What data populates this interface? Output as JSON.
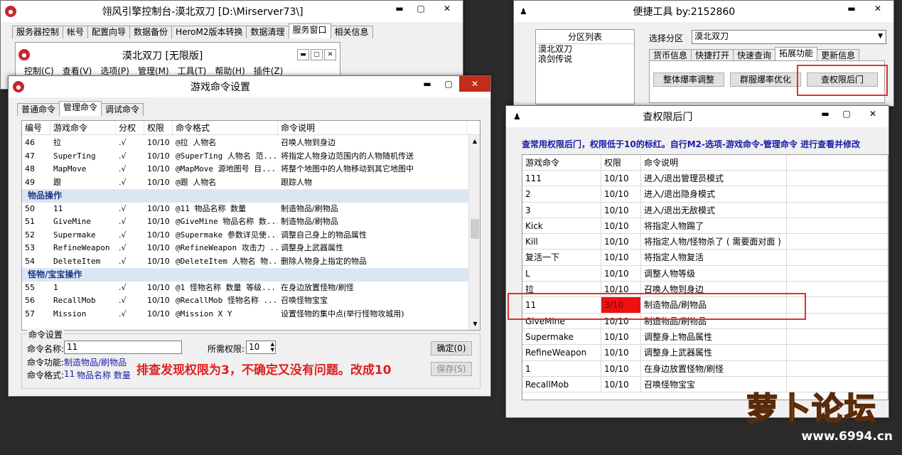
{
  "main_window": {
    "title": "翎风引擎控制台-漠北双刀 [D:\\Mirserver73\\]",
    "tabs": [
      "服务器控制",
      "帐号",
      "配置向导",
      "数据备份",
      "HeroM2版本转换",
      "数据清理",
      "服务窗口",
      "相关信息"
    ],
    "inner_title": "漠北双刀 [无限版]",
    "menu": [
      "控制(C)",
      "查看(V)",
      "选项(P)",
      "管理(M)",
      "工具(T)",
      "帮助(H)",
      "插件(Z)"
    ]
  },
  "cmd_window": {
    "title": "游戏命令设置",
    "tabs": [
      "普通命令",
      "管理命令",
      "调试命令"
    ],
    "columns": [
      "编号",
      "游戏命令",
      "分权",
      "权限",
      "命令格式",
      "命令说明"
    ],
    "rows": [
      {
        "type": "item",
        "id": "46",
        "cmd": "拉",
        "split": ".√",
        "perm": "10/10",
        "fmt": "@拉 人物名",
        "desc": "召唤人物到身边"
      },
      {
        "type": "item",
        "id": "47",
        "cmd": "SuperTing",
        "split": ".√",
        "perm": "10/10",
        "fmt": "@SuperTing 人物名 范...",
        "desc": "将指定人物身边范围内的人物随机传送"
      },
      {
        "type": "item",
        "id": "48",
        "cmd": "MapMove",
        "split": ".√",
        "perm": "10/10",
        "fmt": "@MapMove 源地图号 目...",
        "desc": "将整个地图中的人物移动到其它地图中"
      },
      {
        "type": "item",
        "id": "49",
        "cmd": "跟",
        "split": ".√",
        "perm": "10/10",
        "fmt": "@跟 人物名",
        "desc": "跟踪人物"
      },
      {
        "type": "group",
        "label": "物品操作"
      },
      {
        "type": "item",
        "id": "50",
        "cmd": "11",
        "split": ".√",
        "perm": "10/10",
        "fmt": "@11 物品名称 数量",
        "desc": "制造物品/刷物品"
      },
      {
        "type": "item",
        "id": "51",
        "cmd": "GiveMine",
        "split": ".√",
        "perm": "10/10",
        "fmt": "@GiveMine 物品名称 数...",
        "desc": "制造物品/刷物品"
      },
      {
        "type": "item",
        "id": "52",
        "cmd": "Supermake",
        "split": ".√",
        "perm": "10/10",
        "fmt": "@Supermake 参数详见使...",
        "desc": "调整自己身上的物品属性"
      },
      {
        "type": "item",
        "id": "53",
        "cmd": "RefineWeapon",
        "split": ".√",
        "perm": "10/10",
        "fmt": "@RefineWeapon 攻击力 ...",
        "desc": "调整身上武器属性"
      },
      {
        "type": "item",
        "id": "54",
        "cmd": "DeleteItem",
        "split": ".√",
        "perm": "10/10",
        "fmt": "@DeleteItem 人物名 物...",
        "desc": "删除人物身上指定的物品"
      },
      {
        "type": "group",
        "label": "怪物/宝宝操作"
      },
      {
        "type": "item",
        "id": "55",
        "cmd": "1",
        "split": ".√",
        "perm": "10/10",
        "fmt": "@1 怪物名称 数量 等级...",
        "desc": "在身边放置怪物/刷怪"
      },
      {
        "type": "item",
        "id": "56",
        "cmd": "RecallMob",
        "split": ".√",
        "perm": "10/10",
        "fmt": "@RecallMob 怪物名称 ...",
        "desc": "召唤怪物宝宝"
      },
      {
        "type": "item",
        "id": "57",
        "cmd": "Mission",
        "split": ".√",
        "perm": "10/10",
        "fmt": "@Mission X  Y",
        "desc": "设置怪物的集中点(举行怪物攻城用)"
      }
    ],
    "settings_label": "命令设置",
    "name_label": "命令名称:",
    "name_value": "11",
    "perm_label": "所需权限:",
    "perm_value": "10",
    "ok_button": "确定(0)",
    "save_button": "保存(S)",
    "func_label": "命令功能:",
    "func_value": "制造物品/刷物品",
    "fmt_label": "命令格式:",
    "fmt_value_prefix": "11",
    "fmt_value": "物品名称 数量",
    "annotation": "排查发现权限为3，不确定又没有问题。改成10"
  },
  "tool_window": {
    "title": "便捷工具 by:2152860",
    "partition_header": "分区列表",
    "partitions": [
      "漠北双刀",
      "浪剑传说"
    ],
    "select_label": "选择分区",
    "select_value": "漠北双刀",
    "tabs": [
      "货币信息",
      "快捷打开",
      "快速查询",
      "拓展功能",
      "更新信息"
    ],
    "buttons": [
      "整体爆率调整",
      "群服爆率优化",
      "查权限后门"
    ]
  },
  "perm_window": {
    "title": "查权限后门",
    "notice": "查常用权限后门，权限低于10的标红。自行M2-选项-游戏命令-管理命令 进行查看并修改",
    "columns": [
      "游戏命令",
      "权限",
      "命令说明"
    ],
    "rows": [
      {
        "cmd": "111",
        "perm": "10/10",
        "desc": "进入/退出管理员模式"
      },
      {
        "cmd": "2",
        "perm": "10/10",
        "desc": "进入/退出隐身模式"
      },
      {
        "cmd": "3",
        "perm": "10/10",
        "desc": "进入/退出无敌模式"
      },
      {
        "cmd": "Kick",
        "perm": "10/10",
        "desc": "将指定人物踢了"
      },
      {
        "cmd": "Kill",
        "perm": "10/10",
        "desc": "将指定人物/怪物杀了 ( 需要面对面 )"
      },
      {
        "cmd": "复活一下",
        "perm": "10/10",
        "desc": "将指定人物复活"
      },
      {
        "cmd": "L",
        "perm": "10/10",
        "desc": "调整人物等级"
      },
      {
        "cmd": "拉",
        "perm": "10/10",
        "desc": "召唤人物到身边"
      },
      {
        "cmd": "11",
        "perm": "3/10",
        "desc": "制造物品/刷物品",
        "flag": "low"
      },
      {
        "cmd": "GiveMine",
        "perm": "10/10",
        "desc": "制造物品/刷物品"
      },
      {
        "cmd": "Supermake",
        "perm": "10/10",
        "desc": "调整身上物品属性"
      },
      {
        "cmd": "RefineWeapon",
        "perm": "10/10",
        "desc": "调整身上武器属性"
      },
      {
        "cmd": "1",
        "perm": "10/10",
        "desc": "在身边放置怪物/刷怪"
      },
      {
        "cmd": "RecallMob",
        "perm": "10/10",
        "desc": "召唤怪物宝宝"
      }
    ],
    "low_color": "#ee1111"
  },
  "watermark": {
    "logo": "萝卜论坛",
    "url": "www.6994.cn"
  }
}
